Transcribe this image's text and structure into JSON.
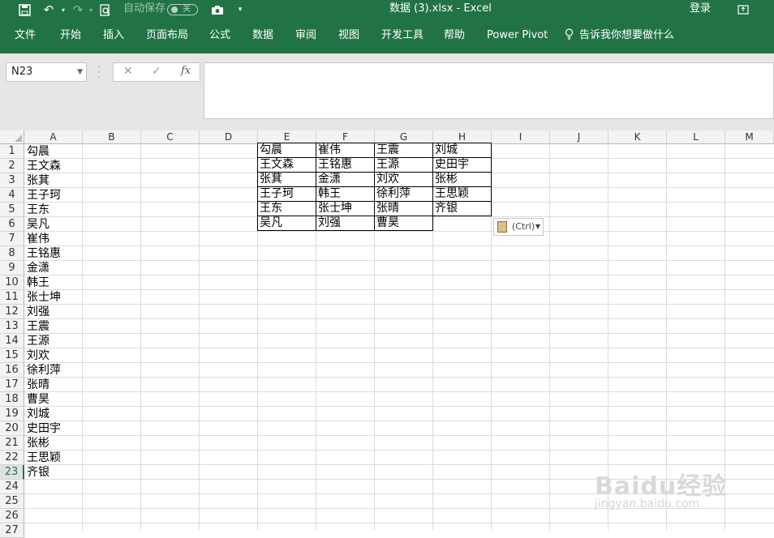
{
  "window": {
    "title": "数据 (3).xlsx  -  Excel",
    "autosave_label": "自动保存",
    "autosave_state": "关",
    "login_label": "登录"
  },
  "ribbon": {
    "tabs": [
      "文件",
      "开始",
      "插入",
      "页面布局",
      "公式",
      "数据",
      "审阅",
      "视图",
      "开发工具",
      "帮助",
      "Power Pivot"
    ],
    "tell_me": "告诉我你想要做什么"
  },
  "formula_bar": {
    "name_box": "N23",
    "fx_label": "fx",
    "cancel_glyph": "✕",
    "enter_glyph": "✓",
    "content": ""
  },
  "sheet": {
    "columns": [
      "A",
      "B",
      "C",
      "D",
      "E",
      "F",
      "G",
      "H",
      "I",
      "J",
      "K",
      "L",
      "M"
    ],
    "rows": [
      "1",
      "2",
      "3",
      "4",
      "5",
      "6",
      "7",
      "8",
      "9",
      "10",
      "11",
      "12",
      "13",
      "14",
      "15",
      "16",
      "17",
      "18",
      "19",
      "20",
      "21",
      "22",
      "23",
      "24",
      "25",
      "26",
      "27"
    ],
    "active_row": "23",
    "column_a": [
      "勾晨",
      "王文森",
      "张萁",
      "王子珂",
      "王东",
      "吴凡",
      "崔伟",
      "王铭惠",
      "金潇",
      "韩王",
      "张士坤",
      "刘强",
      "王震",
      "王源",
      "刘欢",
      "徐利萍",
      "张晴",
      "曹昊",
      "刘城",
      "史田宇",
      "张彬",
      "王思颖",
      "齐银"
    ],
    "table_rows": [
      [
        "勾晨",
        "崔伟",
        "王震",
        "刘城"
      ],
      [
        "王文森",
        "王铭惠",
        "王源",
        "史田宇"
      ],
      [
        "张萁",
        "金潇",
        "刘欢",
        "张彬"
      ],
      [
        "王子珂",
        "韩王",
        "徐利萍",
        "王思颖"
      ],
      [
        "王东",
        "张士坤",
        "张晴",
        "齐银"
      ],
      [
        "吴凡",
        "刘强",
        "曹昊"
      ]
    ]
  },
  "paste_options": {
    "label": "(Ctrl)"
  },
  "watermark": {
    "brand": "Baidu经验",
    "url": "jingyan.baidu.com"
  }
}
